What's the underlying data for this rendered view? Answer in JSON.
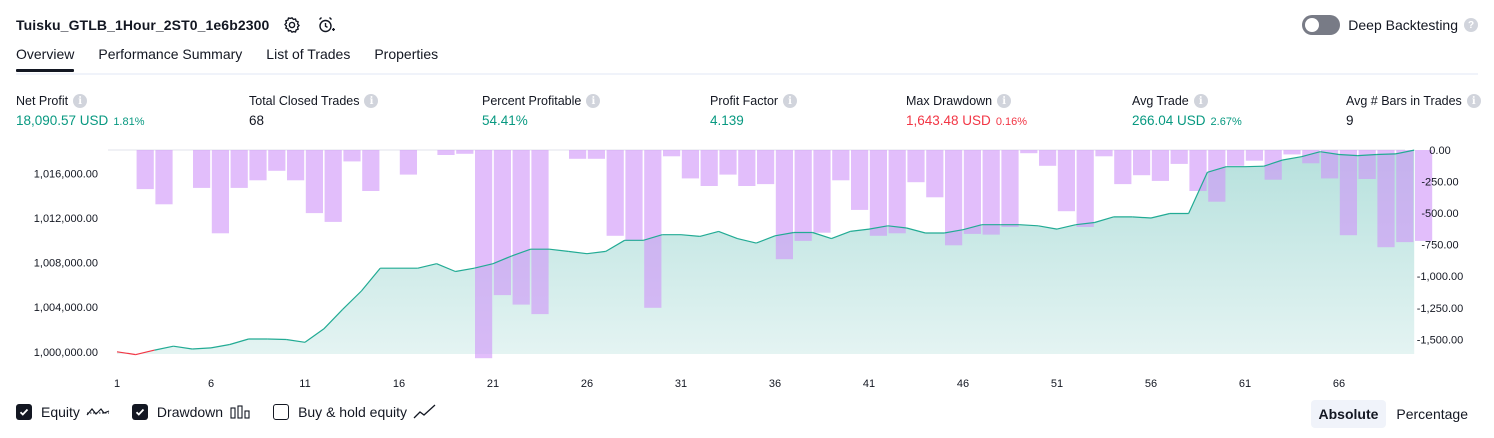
{
  "header": {
    "title": "Tuisku_GTLB_1Hour_2ST0_1e6b2300",
    "deep_backtesting_label": "Deep Backtesting",
    "deep_backtesting_on": false
  },
  "tabs": [
    {
      "label": "Overview",
      "active": true
    },
    {
      "label": "Performance Summary",
      "active": false
    },
    {
      "label": "List of Trades",
      "active": false
    },
    {
      "label": "Properties",
      "active": false
    }
  ],
  "metrics": {
    "net_profit": {
      "label": "Net Profit",
      "value": "18,090.57 USD",
      "pct": "1.81%"
    },
    "total_closed_trades": {
      "label": "Total Closed Trades",
      "value": "68"
    },
    "percent_profitable": {
      "label": "Percent Profitable",
      "value": "54.41%"
    },
    "profit_factor": {
      "label": "Profit Factor",
      "value": "4.139"
    },
    "max_drawdown": {
      "label": "Max Drawdown",
      "value": "1,643.48 USD",
      "pct": "0.16%"
    },
    "avg_trade": {
      "label": "Avg Trade",
      "value": "266.04 USD",
      "pct": "2.67%"
    },
    "avg_bars": {
      "label": "Avg # Bars in Trades",
      "value": "9"
    }
  },
  "colors": {
    "green": "#089981",
    "red": "#f23645",
    "drawdown_bar": "#ce93f8",
    "equity_line": "#22ab94",
    "equity_fill": "#b2dfdb"
  },
  "legend": {
    "equity": {
      "label": "Equity",
      "checked": true
    },
    "drawdown": {
      "label": "Drawdown",
      "checked": true
    },
    "buy_hold": {
      "label": "Buy & hold equity",
      "checked": false
    }
  },
  "view_buttons": {
    "absolute": "Absolute",
    "percentage": "Percentage",
    "selected": "absolute"
  },
  "chart_data": {
    "type": "area",
    "x_ticks": [
      "1",
      "6",
      "11",
      "16",
      "21",
      "26",
      "31",
      "36",
      "41",
      "46",
      "51",
      "56",
      "61",
      "66"
    ],
    "y_left_ticks": [
      "1,016,000.00",
      "1,012,000.00",
      "1,008,000.00",
      "1,004,000.00",
      "1,000,000.00"
    ],
    "y_left_values": [
      1016000,
      1012000,
      1008000,
      1004000,
      1000000
    ],
    "y_right_ticks": [
      "0.00",
      "-250.00",
      "-500.00",
      "-750.00",
      "-1,000.00",
      "-1,250.00",
      "-1,500.00"
    ],
    "y_right_values": [
      0,
      -250,
      -500,
      -750,
      -1000,
      -1250,
      -1500
    ],
    "series": [
      {
        "name": "Equity",
        "values": [
          1000000,
          999750,
          1000150,
          1000500,
          1000250,
          1000350,
          1000650,
          1001150,
          1001150,
          1001100,
          1000850,
          1002050,
          1003800,
          1005450,
          1007500,
          1007500,
          1007500,
          1007900,
          1007200,
          1007500,
          1007900,
          1008600,
          1009200,
          1009200,
          1009000,
          1008800,
          1009000,
          1010000,
          1010000,
          1010500,
          1010500,
          1010350,
          1010800,
          1010150,
          1009750,
          1010400,
          1010700,
          1010700,
          1010150,
          1010800,
          1011000,
          1011300,
          1011100,
          1010650,
          1010650,
          1010950,
          1011400,
          1011400,
          1011400,
          1011300,
          1011000,
          1011400,
          1011600,
          1012100,
          1012100,
          1012000,
          1012400,
          1012400,
          1016100,
          1016600,
          1016600,
          1016650,
          1017200,
          1017500,
          1017950,
          1017700,
          1017600,
          1017700,
          1017750,
          1018090.57
        ]
      },
      {
        "name": "Drawdown",
        "values": [
          0,
          -310,
          -430,
          0,
          -300,
          -660,
          -300,
          -240,
          -165,
          -240,
          -500,
          -570,
          -90,
          -325,
          0,
          -195,
          0,
          -40,
          -30,
          -1650,
          -1150,
          -1225,
          -1300,
          0,
          -70,
          -70,
          -680,
          -720,
          -1250,
          -50,
          -225,
          -285,
          -195,
          -285,
          -270,
          -865,
          -720,
          -655,
          -240,
          -475,
          -680,
          -660,
          -255,
          -375,
          -755,
          -665,
          -670,
          -610,
          -25,
          -125,
          -485,
          -610,
          -50,
          -270,
          -200,
          -245,
          -110,
          -325,
          -410,
          -125,
          -85,
          -235,
          -35,
          -105,
          -225,
          -675,
          -230,
          -770,
          -730,
          -720,
          -890
        ]
      }
    ],
    "xlabel": "",
    "ylabel": ""
  }
}
